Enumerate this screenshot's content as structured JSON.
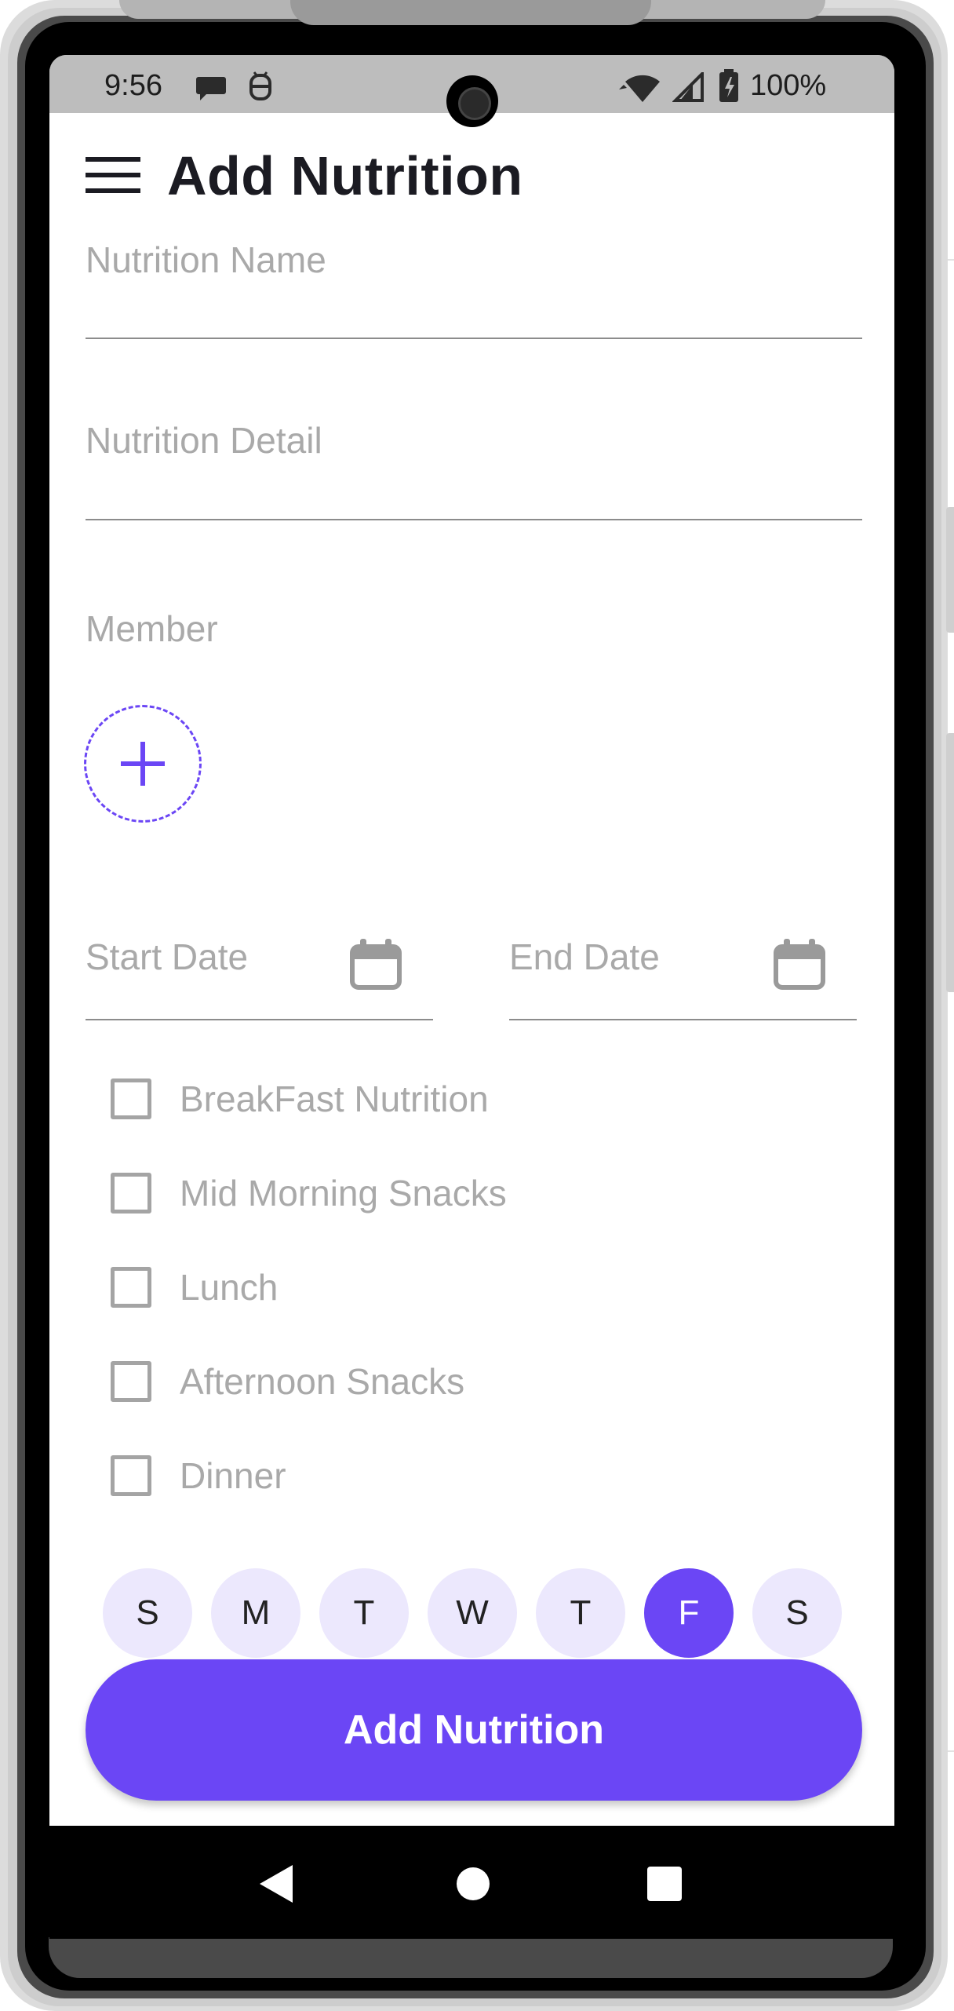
{
  "status_bar": {
    "time": "9:56",
    "battery": "100%",
    "icons": [
      "chat-bubble-icon",
      "android-debug-icon",
      "wifi-icon",
      "cell-signal-icon",
      "battery-charging-icon"
    ]
  },
  "header": {
    "title": "Add Nutrition",
    "menu_icon": "hamburger-menu-icon"
  },
  "form": {
    "nutrition_name": {
      "placeholder": "Nutrition Name",
      "value": ""
    },
    "nutrition_detail": {
      "placeholder": "Nutrition Detail",
      "value": ""
    },
    "member_label": "Member",
    "add_member_icon": "plus-icon",
    "start_date": {
      "placeholder": "Start Date",
      "icon": "calendar-icon"
    },
    "end_date": {
      "placeholder": "End Date",
      "icon": "calendar-icon"
    },
    "meals": [
      {
        "label": "BreakFast Nutrition",
        "checked": false
      },
      {
        "label": "Mid Morning Snacks",
        "checked": false
      },
      {
        "label": "Lunch",
        "checked": false
      },
      {
        "label": "Afternoon Snacks",
        "checked": false
      },
      {
        "label": "Dinner",
        "checked": false
      }
    ],
    "days": [
      {
        "label": "S",
        "selected": false
      },
      {
        "label": "M",
        "selected": false
      },
      {
        "label": "T",
        "selected": false
      },
      {
        "label": "W",
        "selected": false
      },
      {
        "label": "T",
        "selected": false
      },
      {
        "label": "F",
        "selected": true
      },
      {
        "label": "S",
        "selected": false
      }
    ],
    "submit_label": "Add Nutrition"
  },
  "nav_bar": {
    "buttons": [
      "back-triangle-icon",
      "home-circle-icon",
      "recents-square-icon"
    ]
  },
  "colors": {
    "accent": "#6b46f5",
    "chip_bg": "#ece8fd",
    "placeholder": "#a9a9a9",
    "title": "#1b1b22"
  }
}
